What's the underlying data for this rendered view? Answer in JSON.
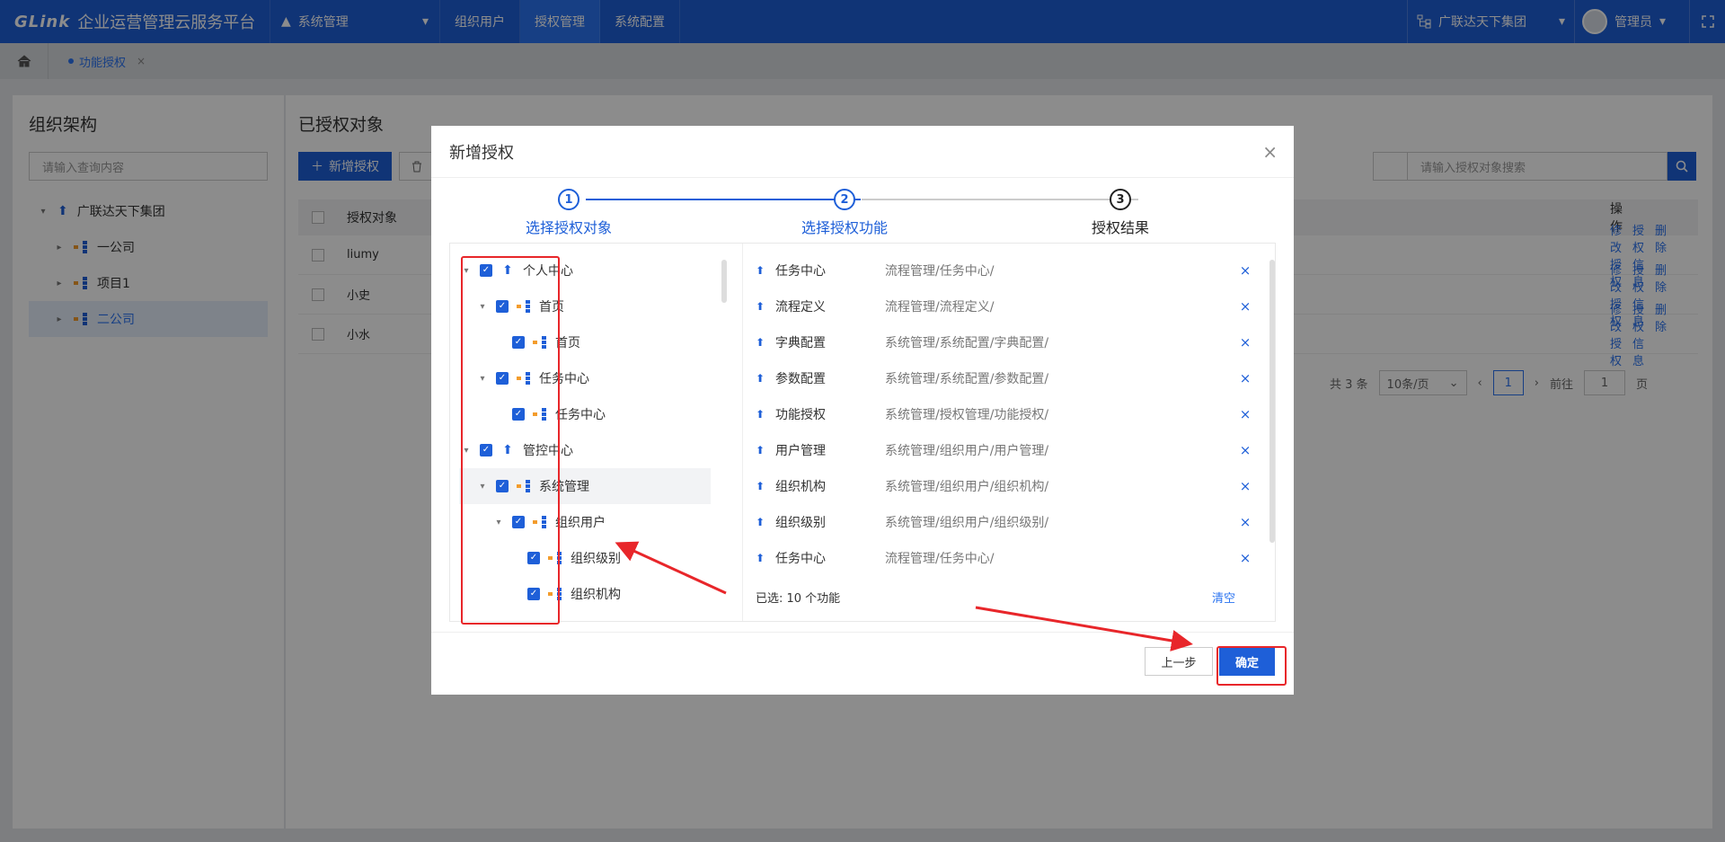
{
  "topbar": {
    "logo": "GLink",
    "platform": "企业运营管理云服务平台",
    "system_menu": "系统管理",
    "tabs": [
      {
        "label": "组织用户"
      },
      {
        "label": "授权管理"
      },
      {
        "label": "系统配置"
      }
    ],
    "org": "广联达天下集团",
    "user": "管理员"
  },
  "breadcrumb": {
    "tab_label": "功能授权",
    "close": "×"
  },
  "left_panel": {
    "title": "组织架构",
    "search_placeholder": "请输入查询内容",
    "tree": [
      {
        "label": "广联达天下集团"
      },
      {
        "label": "一公司"
      },
      {
        "label": "项目1"
      },
      {
        "label": "二公司"
      }
    ]
  },
  "main_panel": {
    "title": "已授权对象",
    "add_button": "新增授权",
    "search_placeholder": "请输入授权对象搜索",
    "columns": {
      "name": "授权对象",
      "ops": "操作"
    },
    "rows": [
      {
        "name": "liumy"
      },
      {
        "name": "小史"
      },
      {
        "name": "小水"
      }
    ],
    "ops": {
      "edit": "修改授权",
      "info": "授权信息",
      "delete": "删除"
    },
    "pager": {
      "total": "共 3 条",
      "page_size": "10条/页",
      "current": "1",
      "goto": "前往",
      "goto_value": "1",
      "page_unit": "页",
      "prev": "‹",
      "next": "›"
    }
  },
  "modal": {
    "title": "新增授权",
    "close": "×",
    "steps": [
      {
        "num": "1",
        "label": "选择授权对象"
      },
      {
        "num": "2",
        "label": "选择授权功能"
      },
      {
        "num": "3",
        "label": "授权结果"
      }
    ],
    "tree": [
      {
        "label": "个人中心"
      },
      {
        "label": "首页"
      },
      {
        "label": "首页"
      },
      {
        "label": "任务中心"
      },
      {
        "label": "任务中心"
      },
      {
        "label": "管控中心"
      },
      {
        "label": "系统管理"
      },
      {
        "label": "组织用户"
      },
      {
        "label": "组织级别"
      },
      {
        "label": "组织机构"
      }
    ],
    "selected": [
      {
        "name": "任务中心",
        "path": "流程管理/任务中心/"
      },
      {
        "name": "流程定义",
        "path": "流程管理/流程定义/"
      },
      {
        "name": "字典配置",
        "path": "系统管理/系统配置/字典配置/"
      },
      {
        "name": "参数配置",
        "path": "系统管理/系统配置/参数配置/"
      },
      {
        "name": "功能授权",
        "path": "系统管理/授权管理/功能授权/"
      },
      {
        "name": "用户管理",
        "path": "系统管理/组织用户/用户管理/"
      },
      {
        "name": "组织机构",
        "path": "系统管理/组织用户/组织机构/"
      },
      {
        "name": "组织级别",
        "path": "系统管理/组织用户/组织级别/"
      },
      {
        "name": "任务中心",
        "path": "流程管理/任务中心/"
      }
    ],
    "remove_icon": "×",
    "selected_count": "已选: 10 个功能",
    "clear": "清空",
    "prev_button": "上一步",
    "ok_button": "确定"
  },
  "colors": {
    "primary": "#1e5fd8",
    "annotation": "#e8262a"
  }
}
